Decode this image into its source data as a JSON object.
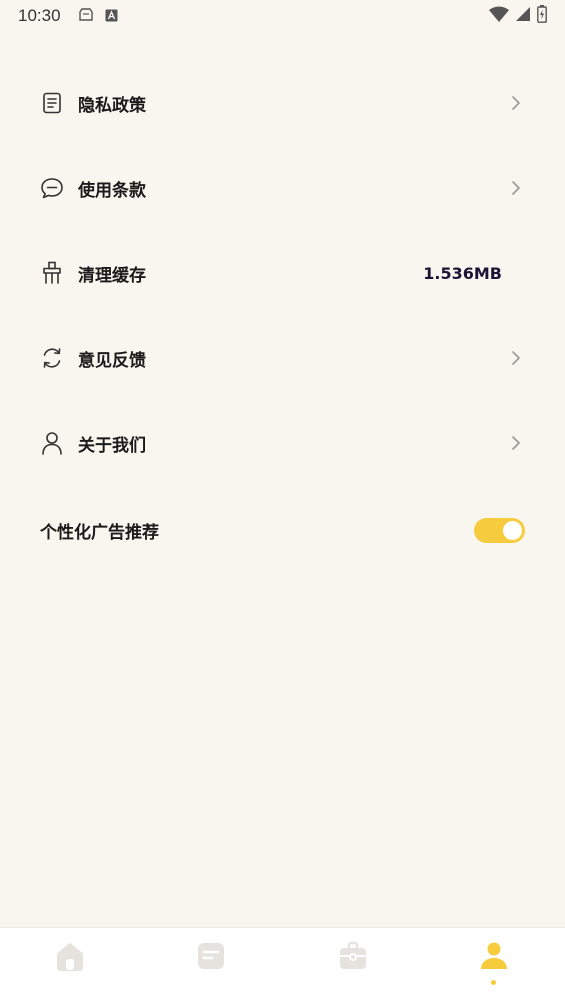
{
  "status_bar": {
    "time": "10:30"
  },
  "menu": {
    "items": [
      {
        "label": "隐私政策",
        "icon": "document-icon",
        "has_arrow": true
      },
      {
        "label": "使用条款",
        "icon": "message-icon",
        "has_arrow": true
      },
      {
        "label": "清理缓存",
        "icon": "brush-icon",
        "value": "1.536MB"
      },
      {
        "label": "意见反馈",
        "icon": "refresh-icon",
        "has_arrow": true
      },
      {
        "label": "关于我们",
        "icon": "user-icon",
        "has_arrow": true
      }
    ]
  },
  "ad_setting": {
    "label": "个性化广告推荐",
    "enabled": true
  },
  "bottom_nav": {
    "tabs": [
      {
        "icon": "home-icon",
        "active": false
      },
      {
        "icon": "note-icon",
        "active": false
      },
      {
        "icon": "toolbox-icon",
        "active": false
      },
      {
        "icon": "profile-icon",
        "active": true
      }
    ]
  },
  "colors": {
    "background": "#f9f6ef",
    "accent": "#f7cb3e",
    "inactive_icon": "#e6e3de",
    "cache_value": "#1d1336"
  }
}
